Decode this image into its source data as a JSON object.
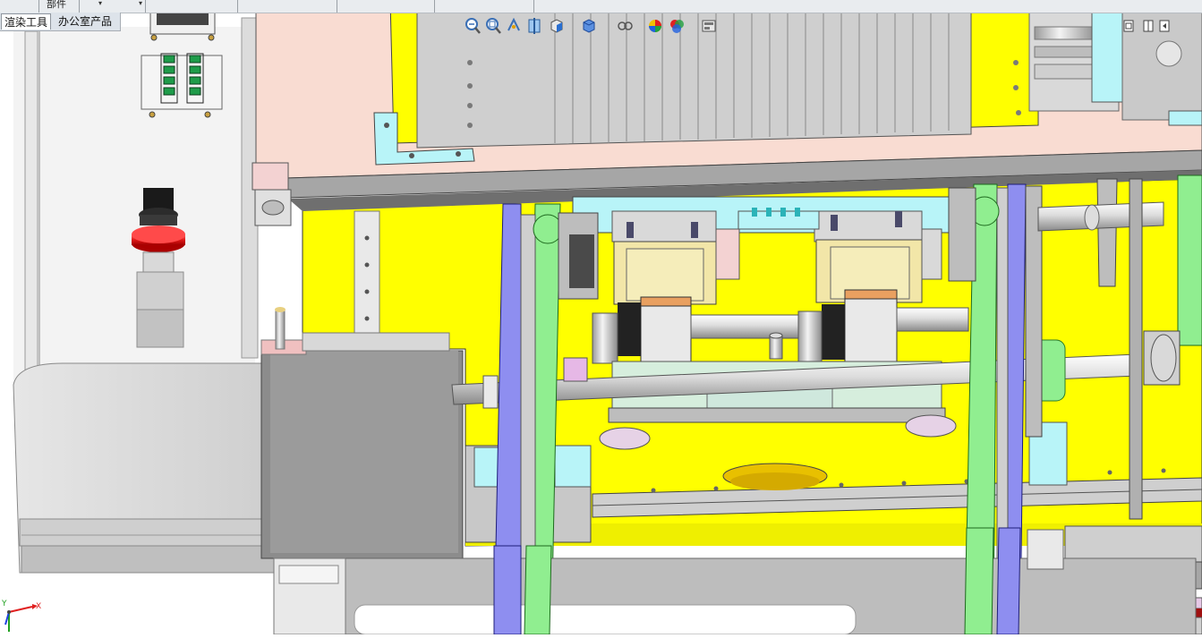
{
  "menu": {
    "tabs": [
      "部件"
    ],
    "dropdown_arrow": "▾"
  },
  "command_tabs": [
    {
      "label": "渲染工具",
      "active": true
    },
    {
      "label": "办公室产品",
      "active": false
    }
  ],
  "heads_up_toolbar": {
    "icons": [
      "zoom-to-fit-icon",
      "zoom-to-area-icon",
      "previous-view-icon",
      "section-view-icon",
      "view-orientation-icon",
      "display-style-icon",
      "hide-show-items-icon",
      "edit-appearance-icon",
      "apply-scene-icon",
      "view-settings-icon"
    ]
  },
  "triad": {
    "x_label": "X",
    "y_label": "Y",
    "colors": {
      "x": "#e02020",
      "y": "#20a020",
      "z": "#2040e0"
    }
  },
  "colors": {
    "viewport_background": "#ffffff",
    "base_plate": "#ffff00",
    "top_plate": "#f9dcd2",
    "rail_blue": "#8e8ef0",
    "rail_green": "#90ee90",
    "cyan_parts": "#b8f4f8",
    "emergency_button": "#ee1c1c",
    "frame_gray": "#c4c4c4"
  }
}
